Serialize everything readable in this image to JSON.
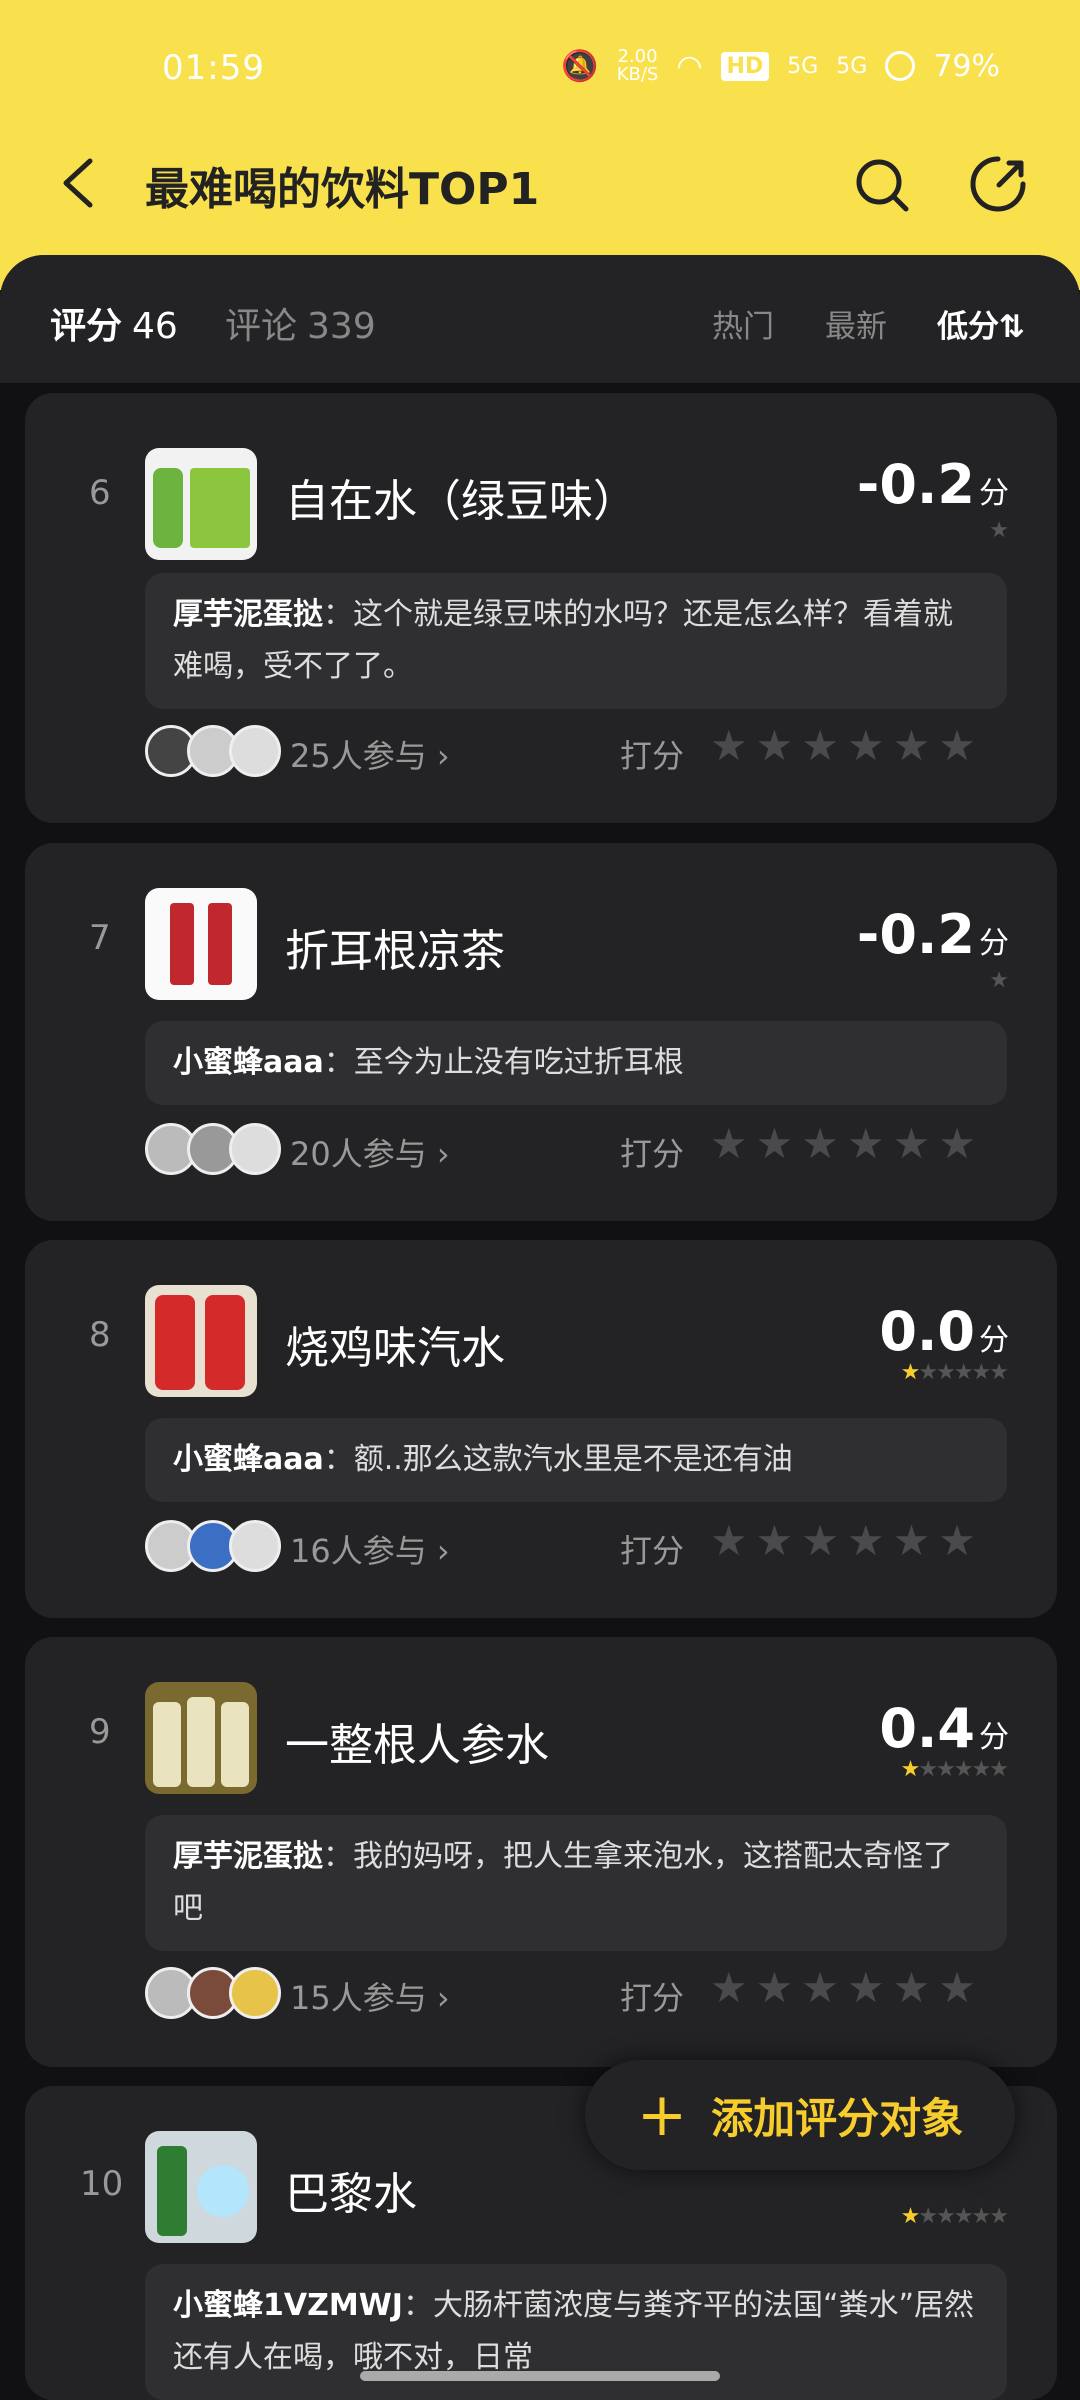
{
  "status": {
    "time": "01:59",
    "speed_value": "2.00",
    "speed_unit": "KB/S",
    "hd": "HD",
    "sig1": "5G",
    "sig2": "5G",
    "battery": "79%"
  },
  "header": {
    "title": "最难喝的饮料TOP1"
  },
  "tabs": {
    "score_label": "评分",
    "score_count": "46",
    "comment_label": "评论",
    "comment_count": "339"
  },
  "sort": {
    "hot": "热门",
    "new": "最新",
    "low": "低分",
    "low_icon": "⇅"
  },
  "items": [
    {
      "rank": "6",
      "name": "自在水（绿豆味）",
      "score": "-0.2",
      "unit": "分",
      "comment_user": "厚芋泥蛋挞",
      "comment_text": "：这个就是绿豆味的水吗？还是怎么样？看着就难喝，受不了了。",
      "participants": "25人参与",
      "rate_label": "打分",
      "thumb_color": "#6db33f"
    },
    {
      "rank": "7",
      "name": "折耳根凉茶",
      "score": "-0.2",
      "unit": "分",
      "comment_user": "小蜜蜂aaa",
      "comment_text": "：至今为止没有吃过折耳根",
      "participants": "20人参与",
      "rate_label": "打分",
      "thumb_color": "#c0282d"
    },
    {
      "rank": "8",
      "name": "烧鸡味汽水",
      "score": "0.0",
      "unit": "分",
      "comment_user": "小蜜蜂aaa",
      "comment_text": "：额..那么这款汽水里是不是还有油",
      "participants": "16人参与",
      "rate_label": "打分",
      "thumb_color": "#d42a2a"
    },
    {
      "rank": "9",
      "name": "一整根人参水",
      "score": "0.4",
      "unit": "分",
      "comment_user": "厚芋泥蛋挞",
      "comment_text": "：我的妈呀，把人生拿来泡水，这搭配太奇怪了吧",
      "participants": "15人参与",
      "rate_label": "打分",
      "thumb_color": "#b59a3a"
    },
    {
      "rank": "10",
      "name": "巴黎水",
      "score": "",
      "unit": "",
      "comment_user": "小蜜蜂1VZMWJ",
      "comment_text": "：大肠杆菌浓度与粪齐平的法国“粪水”居然还有人在喝，哦不对，日常",
      "participants": "",
      "rate_label": "",
      "thumb_color": "#2e7d32"
    }
  ],
  "fab": {
    "plus": "+",
    "label": "添加评分对象"
  }
}
